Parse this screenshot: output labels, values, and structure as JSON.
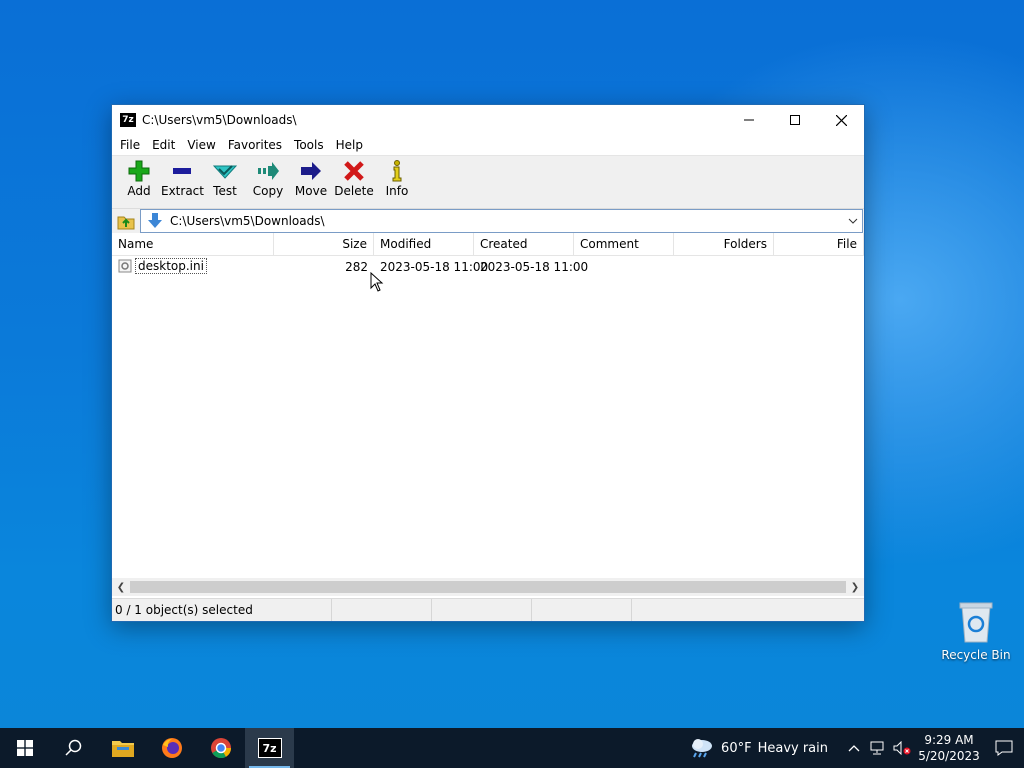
{
  "window": {
    "title": "C:\\Users\\vm5\\Downloads\\",
    "app_icon_text": "7z"
  },
  "menu": [
    "File",
    "Edit",
    "View",
    "Favorites",
    "Tools",
    "Help"
  ],
  "toolbar": [
    {
      "label": "Add",
      "icon": "add-icon",
      "color": "#1aa81a"
    },
    {
      "label": "Extract",
      "icon": "extract-icon",
      "color": "#1c1c9c"
    },
    {
      "label": "Test",
      "icon": "test-icon",
      "color": "#2fc4c4"
    },
    {
      "label": "Copy",
      "icon": "copy-icon",
      "color": "#1e8a78"
    },
    {
      "label": "Move",
      "icon": "move-icon",
      "color": "#1c1c8a"
    },
    {
      "label": "Delete",
      "icon": "delete-icon",
      "color": "#d11818"
    },
    {
      "label": "Info",
      "icon": "info-icon",
      "color": "#c8b400"
    }
  ],
  "address": {
    "path": "C:\\Users\\vm5\\Downloads\\"
  },
  "columns": [
    "Name",
    "Size",
    "Modified",
    "Created",
    "Comment",
    "Folders",
    "File"
  ],
  "files": [
    {
      "name": "desktop.ini",
      "size": "282",
      "modified": "2023-05-18 11:00",
      "created": "2023-05-18 11:00",
      "comment": "",
      "folders": "",
      "files": ""
    }
  ],
  "status": {
    "selection": "0 / 1 object(s) selected"
  },
  "desktop": {
    "recycle_bin": "Recycle Bin"
  },
  "taskbar": {
    "weather_temp": "60°F",
    "weather_text": "Heavy rain",
    "time": "9:29 AM",
    "date": "5/20/2023",
    "active_app_text": "7z"
  }
}
